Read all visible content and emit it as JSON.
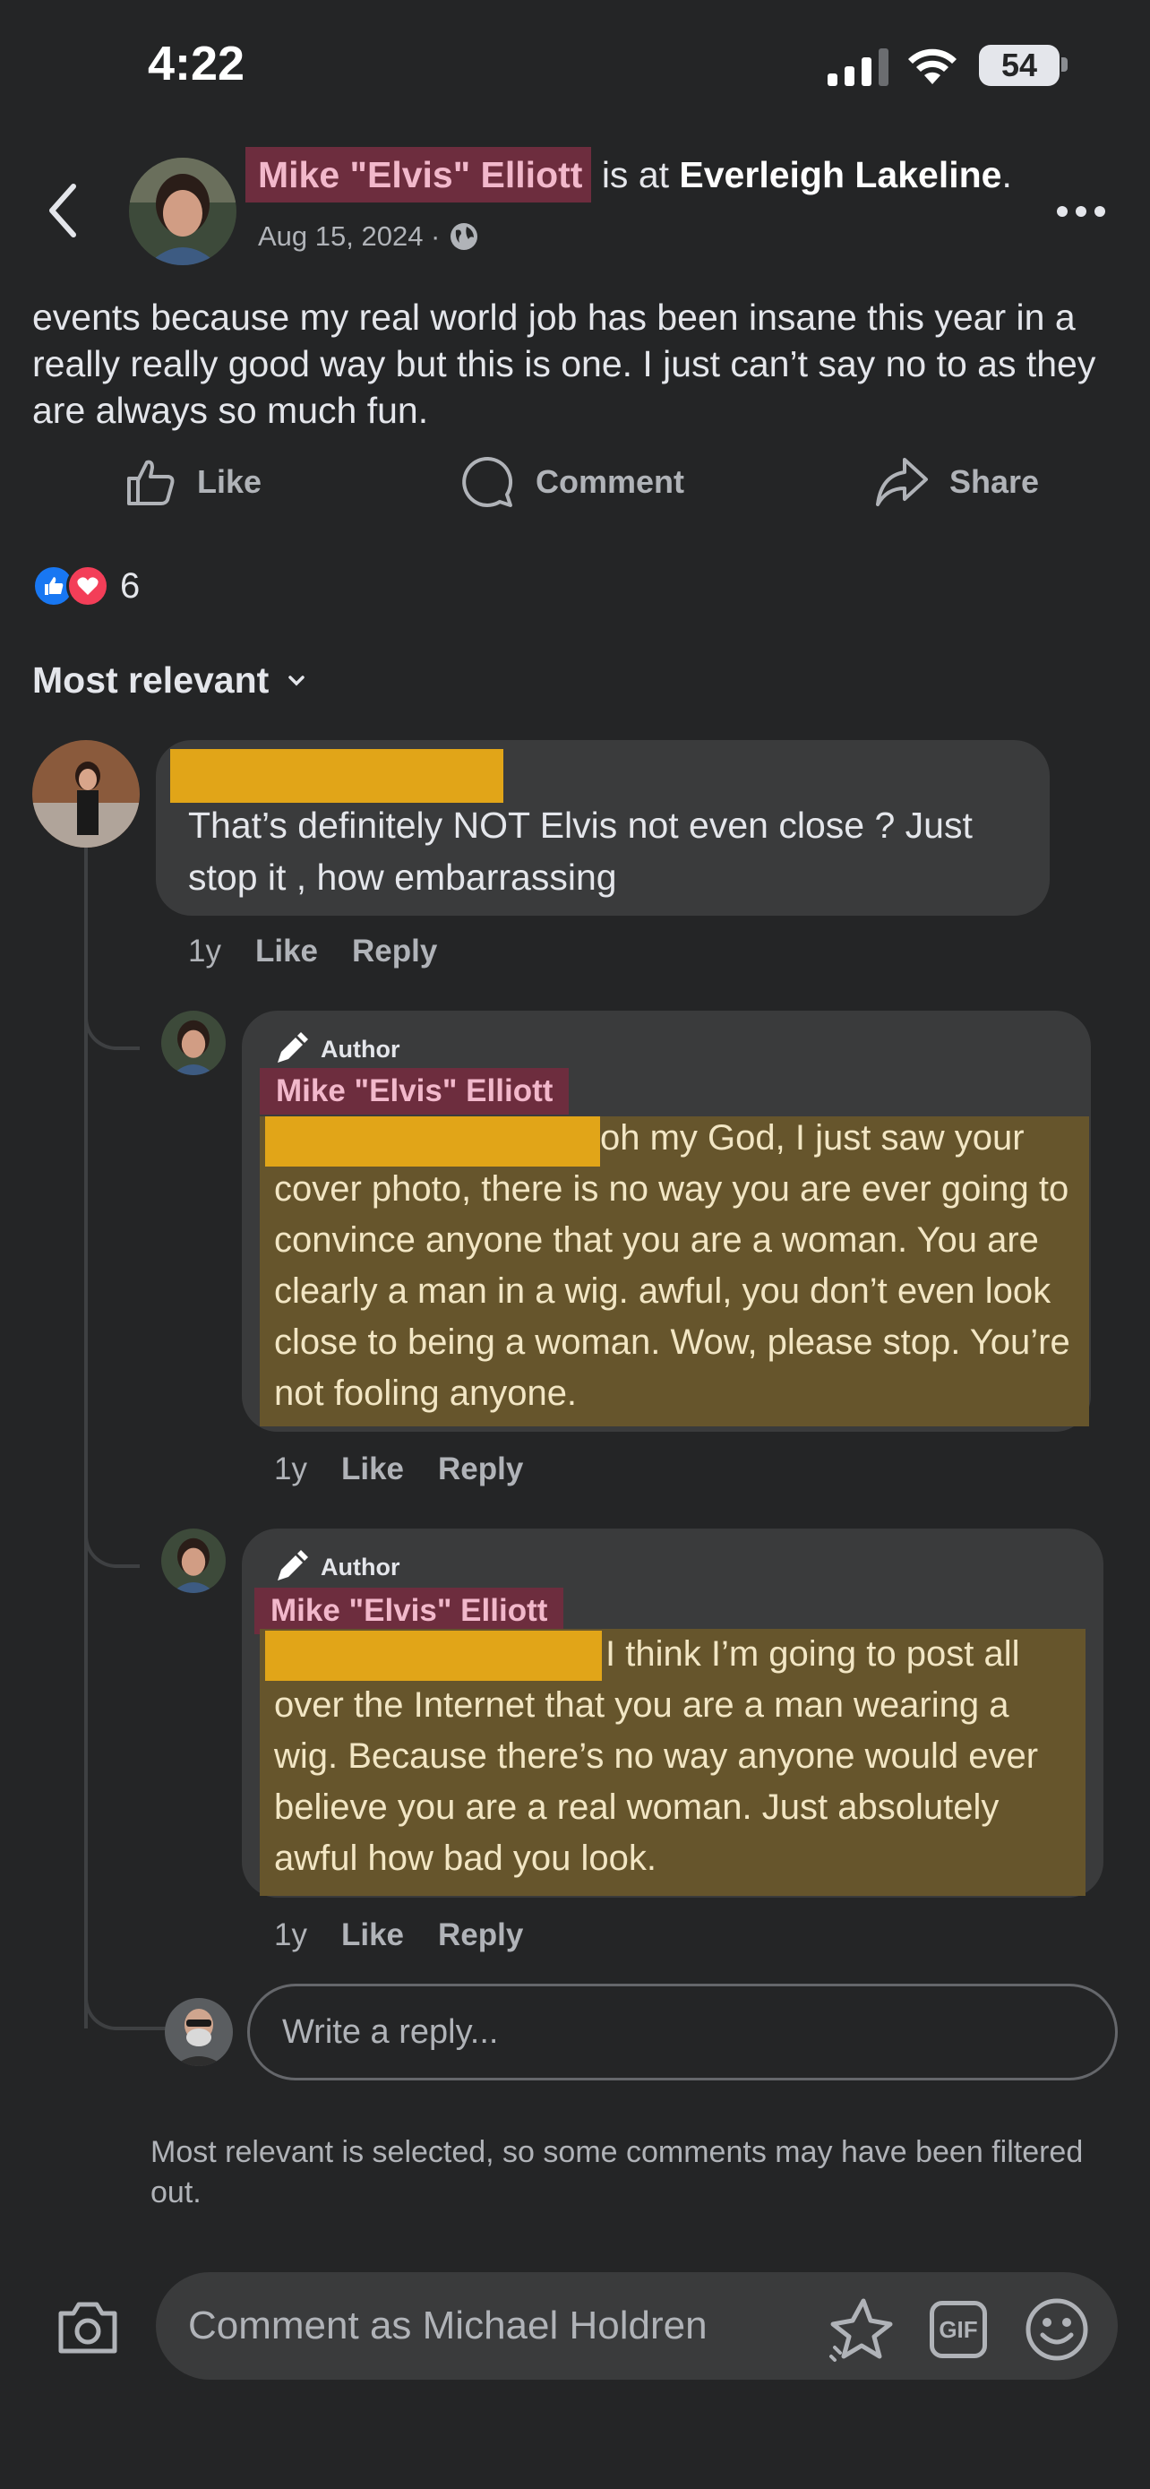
{
  "status_bar": {
    "time": "4:22",
    "battery": "54"
  },
  "header": {
    "name": "Mike \"Elvis\" Elliott",
    "is_at": " is at ",
    "place": "Everleigh Lakeline",
    "period": ".",
    "date": "Aug 15, 2024 ·"
  },
  "post": {
    "text": "events because my real world job has been insane this year in a really really good way but this is one. I just can’t say no to as they are always so much fun."
  },
  "actions": {
    "like": "Like",
    "comment": "Comment",
    "share": "Share"
  },
  "reactions": {
    "count": "6"
  },
  "sort": {
    "label": "Most relevant"
  },
  "comments": [
    {
      "text": "That’s definitely NOT Elvis not even close ? Just stop it , how embarrassing",
      "time": "1y",
      "like": "Like",
      "reply": "Reply"
    }
  ],
  "replies": [
    {
      "badge": "Author",
      "name": "Mike \"Elvis\" Elliott",
      "text": "oh my God, I just saw your cover photo, there is no way you are ever going to convince anyone that you are a woman. You are clearly a man in a wig. awful, you don’t even look close to being a woman. Wow, please stop. You’re not fooling anyone.",
      "time": "1y",
      "like": "Like",
      "reply": "Reply"
    },
    {
      "badge": "Author",
      "name": "Mike \"Elvis\" Elliott",
      "text": "I think I’m going to post all over the Internet that you are a man wearing a wig. Because there’s no way anyone would ever believe you are a real woman. Just absolutely awful how bad you look.",
      "time": "1y",
      "like": "Like",
      "reply": "Reply"
    }
  ],
  "reply_input": {
    "placeholder": "Write a reply..."
  },
  "filter_note": "Most relevant is selected, so some comments may have been filtered out.",
  "composer": {
    "placeholder": "Comment as Michael Holdren",
    "gif": "GIF"
  },
  "colors": {
    "background": "#242526",
    "bubble": "#3a3b3c",
    "name_highlight": "#6d2d3e",
    "redaction": "#e1a518",
    "text_highlight": "#66552c",
    "like_blue": "#1877f2",
    "love_red": "#f33e58"
  },
  "icons": [
    "back-icon",
    "more-icon",
    "globe-icon",
    "thumbs-up-icon",
    "comment-icon",
    "share-icon",
    "chevron-down-icon",
    "pencil-icon",
    "camera-icon",
    "sparkle-sticker-icon",
    "gif-icon",
    "smiley-icon"
  ]
}
